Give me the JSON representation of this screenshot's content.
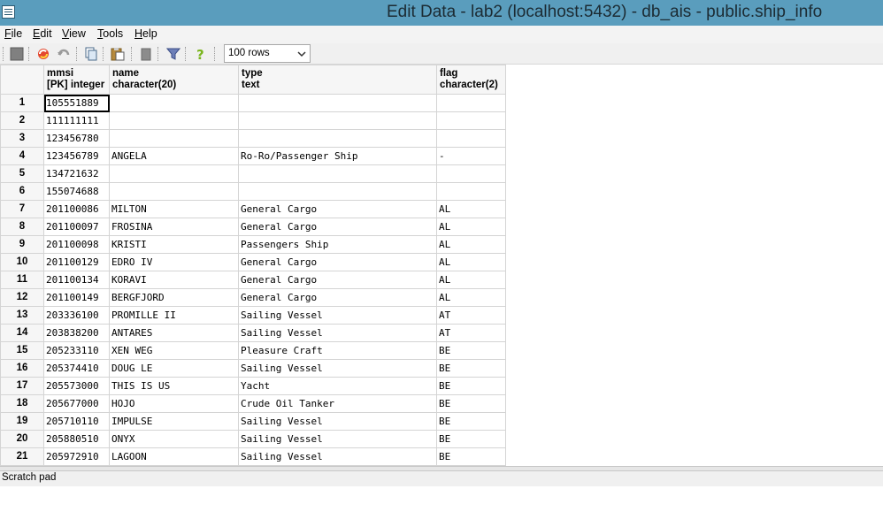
{
  "window": {
    "title": "Edit Data - lab2 (localhost:5432) - db_ais - public.ship_info",
    "icon": "data-grid-icon"
  },
  "menu": {
    "items": [
      {
        "label": "File",
        "underline": "F"
      },
      {
        "label": "Edit",
        "underline": "E"
      },
      {
        "label": "View",
        "underline": "V"
      },
      {
        "label": "Tools",
        "underline": "T"
      },
      {
        "label": "Help",
        "underline": "H"
      }
    ]
  },
  "toolbar": {
    "tools": [
      "save-icon",
      "refresh-icon",
      "undo-icon",
      "copy-icon",
      "paste-icon",
      "delete-icon",
      "filter-icon",
      "help-icon"
    ],
    "rows_limit": "100 rows"
  },
  "grid": {
    "columns": [
      {
        "name": "mmsi",
        "type": "[PK] integer"
      },
      {
        "name": "name",
        "type": "character(20)"
      },
      {
        "name": "type",
        "type": "text"
      },
      {
        "name": "flag",
        "type": "character(2)"
      }
    ],
    "rows": [
      {
        "n": "1",
        "mmsi": "105551889",
        "name": "",
        "type": "",
        "flag": ""
      },
      {
        "n": "2",
        "mmsi": "111111111",
        "name": "",
        "type": "",
        "flag": ""
      },
      {
        "n": "3",
        "mmsi": "123456780",
        "name": "",
        "type": "",
        "flag": ""
      },
      {
        "n": "4",
        "mmsi": "123456789",
        "name": "ANGELA",
        "type": "Ro-Ro/Passenger Ship",
        "flag": "-"
      },
      {
        "n": "5",
        "mmsi": "134721632",
        "name": "",
        "type": "",
        "flag": ""
      },
      {
        "n": "6",
        "mmsi": "155074688",
        "name": "",
        "type": "",
        "flag": ""
      },
      {
        "n": "7",
        "mmsi": "201100086",
        "name": "MILTON",
        "type": "General Cargo",
        "flag": "AL"
      },
      {
        "n": "8",
        "mmsi": "201100097",
        "name": "FROSINA",
        "type": "General Cargo",
        "flag": "AL"
      },
      {
        "n": "9",
        "mmsi": "201100098",
        "name": "KRISTI",
        "type": "Passengers Ship",
        "flag": "AL"
      },
      {
        "n": "10",
        "mmsi": "201100129",
        "name": "EDRO IV",
        "type": "General Cargo",
        "flag": "AL"
      },
      {
        "n": "11",
        "mmsi": "201100134",
        "name": "KORAVI",
        "type": "General Cargo",
        "flag": "AL"
      },
      {
        "n": "12",
        "mmsi": "201100149",
        "name": "BERGFJORD",
        "type": "General Cargo",
        "flag": "AL"
      },
      {
        "n": "13",
        "mmsi": "203336100",
        "name": "PROMILLE II",
        "type": "Sailing Vessel",
        "flag": "AT"
      },
      {
        "n": "14",
        "mmsi": "203838200",
        "name": "ANTARES",
        "type": "Sailing Vessel",
        "flag": "AT"
      },
      {
        "n": "15",
        "mmsi": "205233110",
        "name": "XEN WEG",
        "type": "Pleasure Craft",
        "flag": "BE"
      },
      {
        "n": "16",
        "mmsi": "205374410",
        "name": "DOUG LE",
        "type": "Sailing Vessel",
        "flag": "BE"
      },
      {
        "n": "17",
        "mmsi": "205573000",
        "name": "THIS IS US",
        "type": "Yacht",
        "flag": "BE"
      },
      {
        "n": "18",
        "mmsi": "205677000",
        "name": "HOJO",
        "type": "Crude Oil Tanker",
        "flag": "BE"
      },
      {
        "n": "19",
        "mmsi": "205710110",
        "name": "IMPULSE",
        "type": "Sailing Vessel",
        "flag": "BE"
      },
      {
        "n": "20",
        "mmsi": "205880510",
        "name": "ONYX",
        "type": "Sailing Vessel",
        "flag": "BE"
      },
      {
        "n": "21",
        "mmsi": "205972910",
        "name": "LAGOON",
        "type": "Sailing Vessel",
        "flag": "BE"
      }
    ]
  },
  "scratch_pad": {
    "label": "Scratch pad"
  }
}
